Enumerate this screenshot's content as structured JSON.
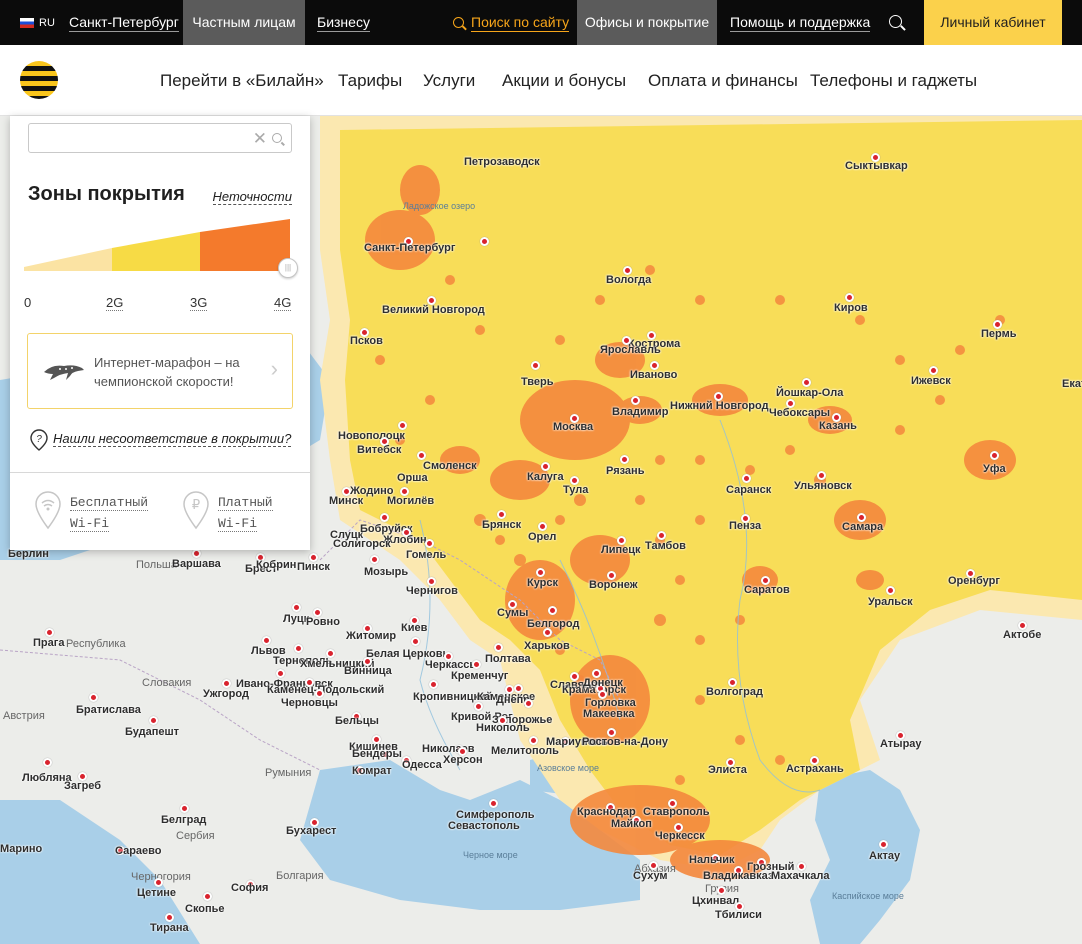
{
  "topbar": {
    "lang": "RU",
    "city": "Санкт-Петербург",
    "tab_private": "Частным лицам",
    "tab_business": "Бизнесу",
    "search_link": "Поиск по сайту",
    "tab_offices": "Офисы и покрытие",
    "help": "Помощь и поддержка",
    "cabinet": "Личный кабинет"
  },
  "nav": {
    "go_beeline": "Перейти в «Билайн»",
    "tariffs": "Тарифы",
    "services": "Услуги",
    "promo": "Акции и бонусы",
    "payment": "Оплата и финансы",
    "phones": "Телефоны и гаджеты"
  },
  "panel": {
    "search_value": "",
    "title": "Зоны покрытия",
    "inaccuracy_link": "Неточности",
    "ticks": [
      "0",
      "2G",
      "3G",
      "4G"
    ],
    "promo_text": "Интернет-марафон – на чемпионской скорости!",
    "mismatch_link": "Нашли несоответствие в покрытии?",
    "wifi_free_1": "Бесплатный",
    "wifi_free_2": "Wi-Fi",
    "wifi_paid_1": "Платный",
    "wifi_paid_2": "Wi-Fi"
  },
  "coverage_colors": {
    "g2": "#fbe3a3",
    "g3": "#f7db45",
    "g4": "#f47a2c"
  },
  "map": {
    "cities": [
      "Петрозаводск",
      "Сыктывкар",
      "Санкт-Петербург",
      "Вологда",
      "Великий Новгород",
      "Киров",
      "Пермь",
      "Псков",
      "Кострома",
      "Ярославль",
      "Иваново",
      "Тверь",
      "Ижевск",
      "Екат",
      "Йошкар-Ола",
      "Нижний Новгород",
      "Владимир",
      "Чебоксары",
      "Казань",
      "Москва",
      "Новополоцк",
      "Витебск",
      "Смоленск",
      "Рязань",
      "Уфа",
      "Калуга",
      "Тула",
      "Орша",
      "Могилёв",
      "Минск",
      "Жодино",
      "Ульяновск",
      "Саранск",
      "Брянск",
      "Слуцк",
      "Бобруйск",
      "Жлобин",
      "Солигорск",
      "Пенза",
      "Самара",
      "Орел",
      "Тамбов",
      "Липецк",
      "Гомель",
      "Берлин",
      "Варшава",
      "Брест",
      "Кобрин",
      "Пинск",
      "Мозырь",
      "Курск",
      "Воронеж",
      "Оренбург",
      "Саратов",
      "Уральск",
      "Чернигов",
      "Сумы",
      "Белгород",
      "Луцк",
      "Ровно",
      "Житомир",
      "Киев",
      "Актобе",
      "Прага",
      "Харьков",
      "Львов",
      "Белая Церковь",
      "Тернополь",
      "Хмельницкий",
      "Винница",
      "Черкассы",
      "Полтава",
      "Кременчуг",
      "Ивано-Франковск",
      "Каменец-Подольский",
      "Ужгород",
      "Черновцы",
      "Кропивницкий",
      "Каменское",
      "Днепр",
      "Славянск",
      "Краматорск",
      "Донецк",
      "Горловка",
      "Макеевка",
      "Кривой Рог",
      "Запорожье",
      "Никополь",
      "Волгоград",
      "Братислава",
      "Будапешт",
      "Бельцы",
      "Мариуполь",
      "Ростов-на-Дону",
      "Атырау",
      "Кишинев",
      "Николаев",
      "Херсон",
      "Мелитополь",
      "Бендеры",
      "Одесса",
      "Комрат",
      "Элиста",
      "Астрахань",
      "Любляна",
      "Загреб",
      "Симферополь",
      "Севастополь",
      "Краснодар",
      "Ставрополь",
      "Майкоп",
      "Черкесск",
      "Белград",
      "Бухарест",
      "Нальчик",
      "Грозный",
      "Владикавказ",
      "Махачкала",
      "Актау",
      "Сараево",
      "Сухум",
      "Цетине",
      "София",
      "Цхинвал",
      "Скопье",
      "Тбилиси",
      "Тирана",
      "Марино"
    ],
    "countries": [
      "Польша",
      "Республика",
      "Словакия",
      "Австрия",
      "Румыния",
      "Сербия",
      "Черногория",
      "Болгария",
      "Абхазия",
      "Грузия"
    ],
    "water": [
      "Ладожское озеро",
      "Азовское море",
      "Черное море",
      "Каспийское море"
    ]
  }
}
